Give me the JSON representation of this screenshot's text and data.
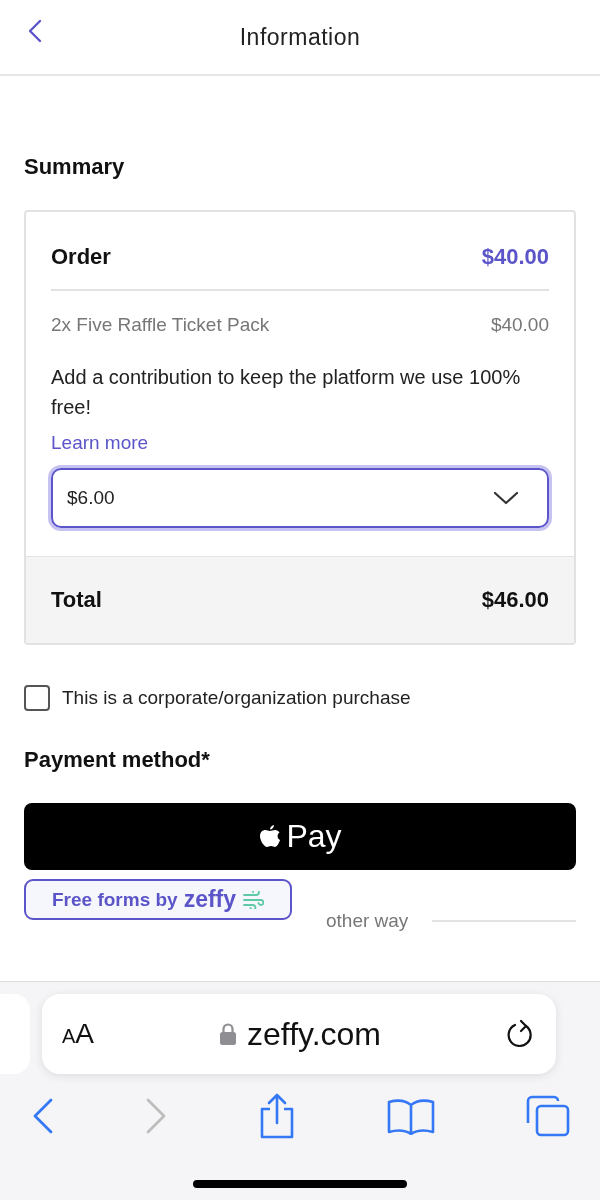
{
  "header": {
    "title": "Information"
  },
  "summary": {
    "heading": "Summary",
    "order_label": "Order",
    "order_total": "$40.00",
    "items": [
      {
        "name": "2x Five Raffle Ticket Pack",
        "price": "$40.00"
      }
    ],
    "contribution_text": "Add a contribution to keep the platform we use 100% free!",
    "learn_more": "Learn more",
    "contribution_select": {
      "value": "$6.00",
      "focused": true
    },
    "total_label": "Total",
    "total": "$46.00"
  },
  "corporate_checkbox": {
    "label": "This is a corporate/organization purchase",
    "checked": false
  },
  "payment": {
    "heading": "Payment method*",
    "apple_pay_label": "Pay",
    "divider_text": "other way"
  },
  "badge": {
    "text": "Free forms by",
    "brand": "zeffy"
  },
  "browser": {
    "text_size_letters": [
      "A",
      "A"
    ],
    "url": "zeffy.com",
    "forward_enabled": false
  }
}
